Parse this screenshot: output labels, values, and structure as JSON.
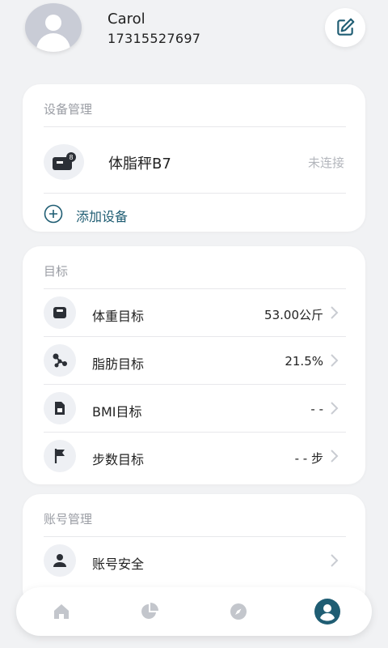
{
  "user": {
    "name": "Carol",
    "phone": "17315527697"
  },
  "device_section": {
    "title": "设备管理",
    "device": {
      "name": "体脂秤B7",
      "status": "未连接",
      "badge": "8"
    },
    "add_label": "添加设备"
  },
  "goals_section": {
    "title": "目标",
    "rows": [
      {
        "label": "体重目标",
        "value": "53.00公斤",
        "icon": "scale-icon"
      },
      {
        "label": "脂肪目标",
        "value": "21.5%",
        "icon": "fat-molecule-icon"
      },
      {
        "label": "BMI目标",
        "value": "- -",
        "icon": "bmi-document-icon"
      },
      {
        "label": "步数目标",
        "value": "- - 步",
        "icon": "flag-icon"
      }
    ]
  },
  "account_section": {
    "title": "账号管理",
    "rows": [
      {
        "label": "账号安全",
        "icon": "user-icon"
      }
    ]
  },
  "tabbar": {
    "active": "profile",
    "tabs": [
      "home-icon",
      "pie-chart-icon",
      "compass-icon",
      "profile-icon"
    ]
  },
  "colors": {
    "accent": "#1f5d73",
    "muted": "#9a9da4",
    "inactive": "#c3c6cc"
  }
}
